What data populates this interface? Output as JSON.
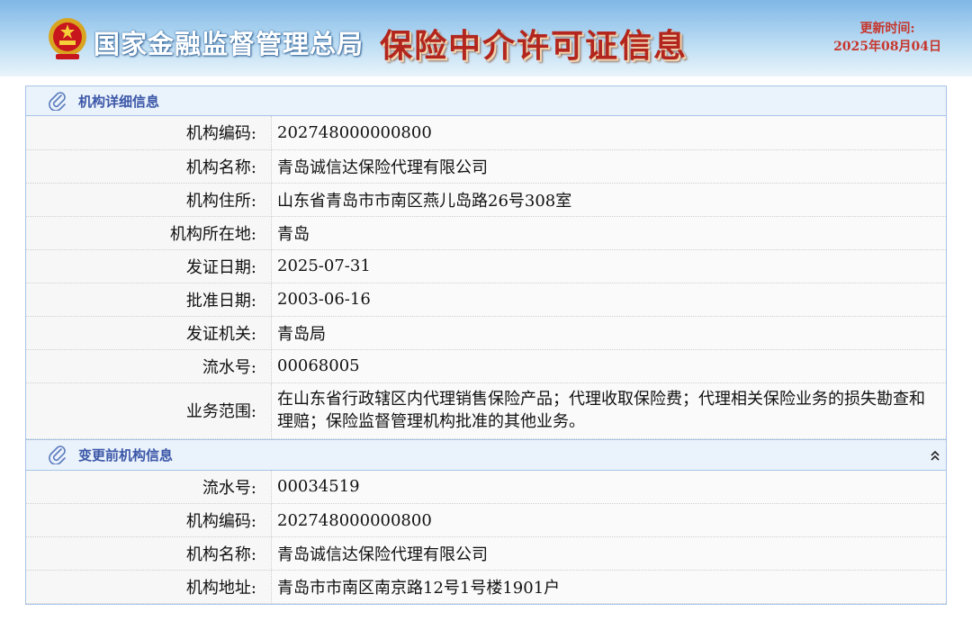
{
  "header": {
    "agency_name": "国家金融监督管理总局",
    "system_title": "保险中介许可证信息",
    "update_label": "更新时间:",
    "update_date": "2025年08月04日"
  },
  "section1": {
    "title": "机构详细信息",
    "rows": [
      {
        "label": "机构编码:",
        "value": "202748000000800"
      },
      {
        "label": "机构名称:",
        "value": "青岛诚信达保险代理有限公司"
      },
      {
        "label": "机构住所:",
        "value": "山东省青岛市市南区燕儿岛路26号308室"
      },
      {
        "label": "机构所在地:",
        "value": "青岛"
      },
      {
        "label": "发证日期:",
        "value": "2025-07-31"
      },
      {
        "label": "批准日期:",
        "value": "2003-06-16"
      },
      {
        "label": "发证机关:",
        "value": "青岛局"
      },
      {
        "label": "流水号:",
        "value": "00068005"
      },
      {
        "label": "业务范围:",
        "value": "在山东省行政辖区内代理销售保险产品；代理收取保险费；代理相关保险业务的损失勘查和理赔；保险监督管理机构批准的其他业务。"
      }
    ]
  },
  "section2": {
    "title": "变更前机构信息",
    "collapse_icon": "double-chevron-up-icon",
    "rows": [
      {
        "label": "流水号:",
        "value": "00034519"
      },
      {
        "label": "机构编码:",
        "value": "202748000000800"
      },
      {
        "label": "机构名称:",
        "value": "青岛诚信达保险代理有限公司"
      },
      {
        "label": "机构地址:",
        "value": "青岛市市南区南京路12号1号楼1901户"
      }
    ]
  },
  "colors": {
    "section_title": "#3b57a8",
    "update_text": "#c6362c",
    "system_title": "#b3261e"
  }
}
